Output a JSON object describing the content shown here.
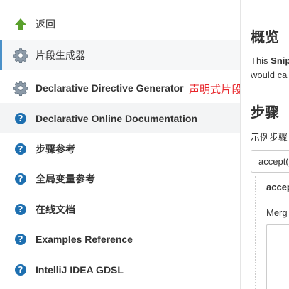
{
  "sidebar": {
    "items": [
      {
        "label": "返回",
        "icon": "green-up-arrow-icon"
      },
      {
        "label": "片段生成器",
        "icon": "gear-icon"
      },
      {
        "label": "Declarative Directive Generator",
        "icon": "gear-icon"
      },
      {
        "label": "Declarative Online Documentation",
        "icon": "help-icon"
      },
      {
        "label": "步骤参考",
        "icon": "help-icon"
      },
      {
        "label": "全局变量参考",
        "icon": "help-icon"
      },
      {
        "label": "在线文档",
        "icon": "help-icon"
      },
      {
        "label": "Examples Reference",
        "icon": "help-icon"
      },
      {
        "label": "IntelliJ IDEA GDSL",
        "icon": "help-icon"
      }
    ]
  },
  "annotation": "声明式片段生成器",
  "main": {
    "overview_title": "概览",
    "overview_prefix": "This ",
    "overview_bold": "Snip",
    "overview_line2": "would ca",
    "steps_title": "步骤",
    "sample_label": "示例步骤",
    "select_value": "accept(",
    "sub_label": "accep",
    "merge_label": "Merg"
  },
  "colors": {
    "active_bar": "#4a90c8",
    "help_icon": "#1d6fb0",
    "annotation": "#e8262b",
    "back_arrow": "#5aa02c"
  }
}
